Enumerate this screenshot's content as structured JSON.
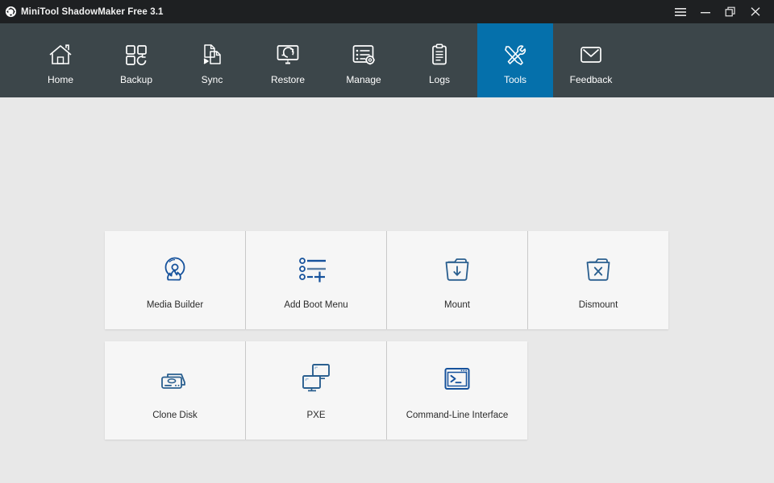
{
  "window": {
    "title": "MiniTool ShadowMaker Free 3.1",
    "logo_icon": "sync-arrows-logo-icon",
    "controls": [
      {
        "name": "menu",
        "label": "☰",
        "icon": "hamburger-menu-icon"
      },
      {
        "name": "minimize",
        "label": "—",
        "icon": "minimize-icon"
      },
      {
        "name": "restore",
        "label": "❐",
        "icon": "restore-icon"
      },
      {
        "name": "close",
        "label": "✕",
        "icon": "close-icon"
      }
    ]
  },
  "nav": {
    "active": "Tools",
    "accent_color": "#0570ab",
    "bar_color": "#3c464a",
    "items": [
      {
        "label": "Home",
        "icon": "home-icon",
        "active": false
      },
      {
        "label": "Backup",
        "icon": "backup-squares-icon",
        "active": false
      },
      {
        "label": "Sync",
        "icon": "sync-files-icon",
        "active": false
      },
      {
        "label": "Restore",
        "icon": "restore-monitor-icon",
        "active": false
      },
      {
        "label": "Manage",
        "icon": "manage-list-gear-icon",
        "active": false
      },
      {
        "label": "Logs",
        "icon": "logs-clipboard-icon",
        "active": false
      },
      {
        "label": "Tools",
        "icon": "tools-wrench-screwdriver-icon",
        "active": true
      },
      {
        "label": "Feedback",
        "icon": "feedback-envelope-icon",
        "active": false
      }
    ]
  },
  "tools": {
    "icon_color": "#16529c",
    "rows": [
      [
        {
          "label": "Media Builder",
          "icon": "media-builder-disc-flame-icon"
        },
        {
          "label": "Add Boot Menu",
          "icon": "add-boot-menu-list-plus-icon"
        },
        {
          "label": "Mount",
          "icon": "mount-folder-down-arrow-icon"
        },
        {
          "label": "Dismount",
          "icon": "dismount-folder-x-icon"
        }
      ],
      [
        {
          "label": "Clone Disk",
          "icon": "clone-disk-hard-drive-icon"
        },
        {
          "label": "PXE",
          "icon": "pxe-two-monitors-icon"
        },
        {
          "label": "Command-Line Interface",
          "icon": "command-line-terminal-icon"
        }
      ]
    ]
  }
}
